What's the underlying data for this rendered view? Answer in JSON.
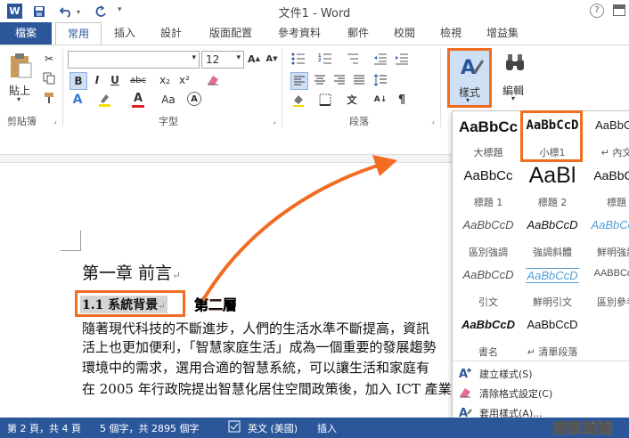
{
  "window": {
    "title": "文件1 - Word"
  },
  "colors": {
    "accent": "#2b579a",
    "highlight": "#f26c22"
  },
  "tabs": [
    {
      "label": "檔案"
    },
    {
      "label": "常用"
    },
    {
      "label": "插入"
    },
    {
      "label": "設計"
    },
    {
      "label": "版面配置"
    },
    {
      "label": "參考資料"
    },
    {
      "label": "郵件"
    },
    {
      "label": "校閱"
    },
    {
      "label": "檢視"
    },
    {
      "label": "增益集"
    }
  ],
  "ribbon": {
    "clipboard": {
      "paste_label": "貼上",
      "group_label": "剪貼簿"
    },
    "font": {
      "font_size": "12",
      "group_label": "字型",
      "bold": "B",
      "italic": "I",
      "underline": "U",
      "strike": "abc",
      "sub": "x₂",
      "sup": "x²"
    },
    "paragraph": {
      "group_label": "段落"
    },
    "styles": {
      "label": "樣式"
    },
    "editing": {
      "label": "編輯"
    }
  },
  "document": {
    "heading": "第一章  前言",
    "subheading": "1.1  系統背景",
    "annotation": "第二層",
    "body": [
      "隨著現代科技的不斷進步，人們的生活水準不斷提高，資訊",
      "活上也更加便利，「智慧家庭生活」成為一個重要的發展趨勢",
      "環境中的需求，選用合適的智慧系統，可以讓生活和家庭有",
      "在 2005 年行政院提出智慧化居住空間政策後，加入 ICT 產業"
    ]
  },
  "styles_gallery": [
    {
      "preview": "AaBbCc",
      "name": "大標題"
    },
    {
      "preview": "AaBbCcD",
      "name": "小標1"
    },
    {
      "preview": "AaBbCc",
      "name": "↵ 內文"
    },
    {
      "preview": "AaBbCc",
      "name": "標題 1"
    },
    {
      "preview": "AaBl",
      "name": "標題 2"
    },
    {
      "preview": "AaBbCc",
      "name": "標題"
    },
    {
      "preview": "AaBbCcD",
      "name": "區別強調"
    },
    {
      "preview": "AaBbCcD",
      "name": "強調斜體"
    },
    {
      "preview": "AaBbCcD",
      "name": "鮮明強調"
    },
    {
      "preview": "AaBbCcD",
      "name": "引文"
    },
    {
      "preview": "AaBbCcD",
      "name": "鮮明引文"
    },
    {
      "preview": "AABBCcD",
      "name": "區別參考"
    },
    {
      "preview": "AaBbCcD",
      "name": "書名"
    },
    {
      "preview": "AaBbCcD",
      "name": "↵ 清單段落"
    }
  ],
  "styles_menu": [
    {
      "label": "建立樣式(S)"
    },
    {
      "label": "清除格式設定(C)"
    },
    {
      "label": "套用樣式(A)..."
    }
  ],
  "status": {
    "page": "第 2 頁，共 4 頁",
    "words": "5 個字，共 2895 個字",
    "language": "英文 (美國)",
    "mode": "插入"
  },
  "watermark": "痞凱踏踏"
}
